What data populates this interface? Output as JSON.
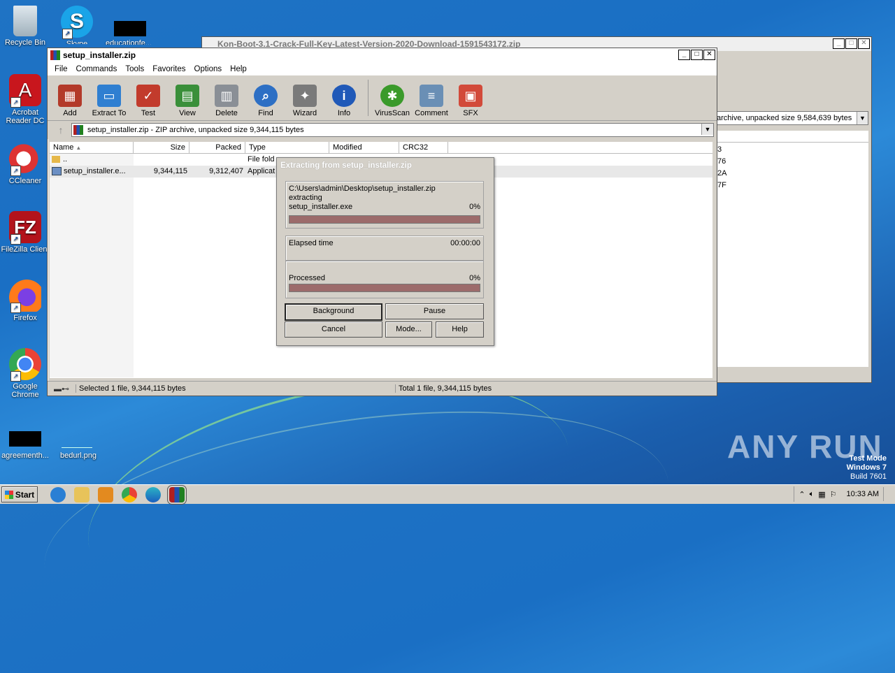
{
  "desktop": {
    "icons": [
      {
        "label": "Recycle Bin"
      },
      {
        "label": "Skype"
      },
      {
        "label": "educationfe..."
      },
      {
        "label": "Acrobat Reader DC"
      },
      {
        "label": "CCleaner"
      },
      {
        "label": "FileZilla Client"
      },
      {
        "label": "Firefox"
      },
      {
        "label": "Google Chrome"
      },
      {
        "label": "agreementh..."
      },
      {
        "label": "bedurl.png"
      }
    ]
  },
  "back_window": {
    "title": "Kon-Boot-3.1-Crack-Full-Key-Latest-Version-2020-Download-1591543172.zip",
    "path": "archive, unpacked size 9,584,639 bytes",
    "crc_fragments": [
      "3",
      "76",
      "2A",
      "7F"
    ]
  },
  "main_window": {
    "title": "setup_installer.zip",
    "menu": [
      "File",
      "Commands",
      "Tools",
      "Favorites",
      "Options",
      "Help"
    ],
    "toolbar": [
      {
        "label": "Add",
        "icon": "add-archive-icon",
        "color": "#b33a2a"
      },
      {
        "label": "Extract To",
        "icon": "folder-extract-icon",
        "color": "#2f7fd1"
      },
      {
        "label": "Test",
        "icon": "test-clipboard-icon",
        "color": "#c23b2c"
      },
      {
        "label": "View",
        "icon": "book-view-icon",
        "color": "#3a8f3a"
      },
      {
        "label": "Delete",
        "icon": "trash-icon",
        "color": "#8a8f96"
      },
      {
        "label": "Find",
        "icon": "magnifier-icon",
        "color": "#2d6fc4"
      },
      {
        "label": "Wizard",
        "icon": "magic-wand-icon",
        "color": "#7a7a7a"
      },
      {
        "label": "Info",
        "icon": "info-icon",
        "color": "#2059b8"
      },
      {
        "label": "VirusScan",
        "icon": "virus-bug-icon",
        "color": "#3a9a2a"
      },
      {
        "label": "Comment",
        "icon": "comment-icon",
        "color": "#6a8fb5"
      },
      {
        "label": "SFX",
        "icon": "sfx-package-icon",
        "color": "#d24a3a"
      }
    ],
    "path": "setup_installer.zip - ZIP archive, unpacked size 9,344,115 bytes",
    "columns": [
      "Name",
      "Size",
      "Packed",
      "Type",
      "Modified",
      "CRC32"
    ],
    "rows": [
      {
        "name": "..",
        "size": "",
        "packed": "",
        "type": "File fold"
      },
      {
        "name": "setup_installer.e...",
        "size": "9,344,115",
        "packed": "9,312,407",
        "type": "Applicat"
      }
    ],
    "status_left": "Selected 1 file, 9,344,115 bytes",
    "status_right": "Total 1 file, 9,344,115 bytes"
  },
  "dialog": {
    "title": "Extracting from setup_installer.zip",
    "archive_path": "C:\\Users\\admin\\Desktop\\setup_installer.zip",
    "action": "extracting",
    "file": "setup_installer.exe",
    "file_percent": "0%",
    "elapsed_label": "Elapsed time",
    "elapsed_value": "00:00:00",
    "processed_label": "Processed",
    "processed_percent": "0%",
    "buttons": {
      "background": "Background",
      "pause": "Pause",
      "cancel": "Cancel",
      "mode": "Mode...",
      "help": "Help"
    }
  },
  "taskbar": {
    "start_label": "Start",
    "time": "10:33 AM"
  },
  "watermark": {
    "line1": "Test Mode",
    "line2": "Windows 7",
    "line3": "Build 7601",
    "brand": "ANY RUN"
  }
}
